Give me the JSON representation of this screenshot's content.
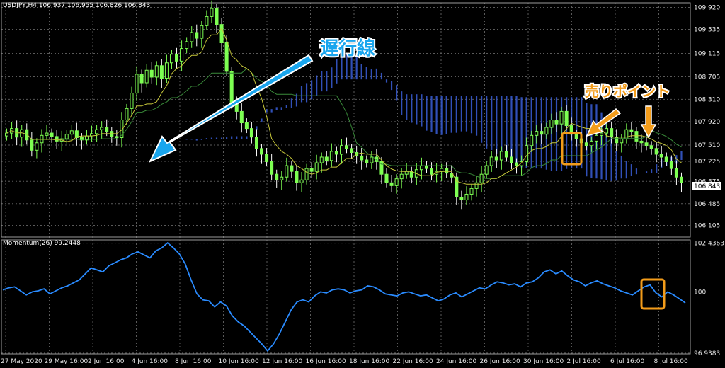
{
  "header": {
    "symbol_line": "USDJPY,H4  106.937 106.955 106.826 106.843"
  },
  "momentum_header": "Momentum(26) 99.2448",
  "annotations": {
    "lagging_span": "遅行線",
    "sell_point": "売りポイント"
  },
  "price_badge": "106.843",
  "colors": {
    "bull_candle": "#7dff52",
    "bear_candle": "#ffffff",
    "lagging_span": "#ff69b4",
    "tenkan": "#c8c83a",
    "kijun": "#3a8c3a",
    "cloud": "#3a5fd9",
    "momentum": "#2a8bff",
    "grid": "#5a5a5a",
    "arrow_blue": "#1aa6ee",
    "marker_orange": "#f39c1a"
  },
  "chart_data": [
    {
      "type": "candlestick",
      "title": "USDJPY,H4",
      "ylim": [
        105.9,
        110.0
      ],
      "y_ticks": [
        "109.920",
        "109.535",
        "109.115",
        "108.705",
        "108.310",
        "107.920",
        "107.510",
        "107.225",
        "106.875",
        "106.485",
        "106.105"
      ],
      "y_tick_values": [
        109.92,
        109.535,
        109.115,
        108.705,
        108.31,
        107.92,
        107.51,
        107.225,
        106.875,
        106.485,
        106.105
      ],
      "x_ticks": [
        "27 May 2020",
        "29 May 16:00",
        "2 Jun 16:00",
        "4 Jun 16:00",
        "8 Jun 16:00",
        "10 Jun 16:00",
        "12 Jun 16:00",
        "16 Jun 16:00",
        "18 Jun 16:00",
        "22 Jun 16:00",
        "24 Jun 16:00",
        "26 Jun 16:00",
        "30 Jun 16:00",
        "2 Jul 16:00",
        "6 Jul 16:00",
        "8 Jul 16:00"
      ],
      "close": [
        107.72,
        107.8,
        107.65,
        107.78,
        107.6,
        107.42,
        107.55,
        107.68,
        107.72,
        107.66,
        107.58,
        107.62,
        107.7,
        107.76,
        107.64,
        107.6,
        107.67,
        107.71,
        107.78,
        107.82,
        107.75,
        107.66,
        107.64,
        107.95,
        108.15,
        108.42,
        108.75,
        108.6,
        108.82,
        108.7,
        108.9,
        108.68,
        108.95,
        109.1,
        108.98,
        109.2,
        109.32,
        109.48,
        109.38,
        109.6,
        109.76,
        109.9,
        109.62,
        109.3,
        108.8,
        108.25,
        108.1,
        107.9,
        107.8,
        107.65,
        107.45,
        107.35,
        107.22,
        107.0,
        106.9,
        106.95,
        107.15,
        107.05,
        106.85,
        106.9,
        107.1,
        107.05,
        107.2,
        107.3,
        107.24,
        107.4,
        107.35,
        107.5,
        107.45,
        107.38,
        107.32,
        107.25,
        107.2,
        107.3,
        107.22,
        107.0,
        106.85,
        106.8,
        106.92,
        107.0,
        107.05,
        106.95,
        107.08,
        107.15,
        107.1,
        107.0,
        107.05,
        107.1,
        107.02,
        106.95,
        106.6,
        106.55,
        106.65,
        106.75,
        106.85,
        107.0,
        107.15,
        107.3,
        107.25,
        107.4,
        107.3,
        107.2,
        107.15,
        107.22,
        107.5,
        107.68,
        107.75,
        107.7,
        107.82,
        107.95,
        107.88,
        108.1,
        107.85,
        107.7,
        107.62,
        107.55,
        107.5,
        107.58,
        107.68,
        107.72,
        107.8,
        107.65,
        107.55,
        107.62,
        107.78,
        107.75,
        107.58,
        107.55,
        107.5,
        107.45,
        107.35,
        107.3,
        107.22,
        107.1,
        106.95,
        106.85
      ]
    },
    {
      "type": "line",
      "title": "Momentum(26) 99.2448",
      "ylim": [
        96.9,
        102.6
      ],
      "y_ticks": [
        "102.4363",
        "100",
        "96.9383"
      ],
      "y_tick_values": [
        102.4363,
        100,
        96.9383
      ],
      "values": [
        100.1,
        100.2,
        100.25,
        100.05,
        99.85,
        100.0,
        100.05,
        100.15,
        99.9,
        100.05,
        100.2,
        100.3,
        100.45,
        100.6,
        100.9,
        101.2,
        101.1,
        101.0,
        101.3,
        101.45,
        101.6,
        101.7,
        101.9,
        102.0,
        101.85,
        101.7,
        102.05,
        102.2,
        102.45,
        102.2,
        101.9,
        101.4,
        100.6,
        99.9,
        99.6,
        99.55,
        99.25,
        99.5,
        99.3,
        98.8,
        98.5,
        98.3,
        98.0,
        97.7,
        97.4,
        97.05,
        97.4,
        97.9,
        98.5,
        99.1,
        99.5,
        99.6,
        99.5,
        99.8,
        100.0,
        99.95,
        100.1,
        100.15,
        100.1,
        99.95,
        100.05,
        100.1,
        100.3,
        100.25,
        100.1,
        99.9,
        99.85,
        99.8,
        99.95,
        100.0,
        99.9,
        99.8,
        99.85,
        99.7,
        99.55,
        99.65,
        99.85,
        99.95,
        99.75,
        99.9,
        100.05,
        100.2,
        100.15,
        100.35,
        100.5,
        100.45,
        100.35,
        100.4,
        100.25,
        100.45,
        100.5,
        100.7,
        101.0,
        101.1,
        100.9,
        101.05,
        100.8,
        100.6,
        100.5,
        100.3,
        100.45,
        100.55,
        100.4,
        100.3,
        100.2,
        100.05,
        99.95,
        99.85,
        100.05,
        100.25,
        100.35,
        99.95,
        99.75,
        100.0,
        99.85,
        99.65,
        99.45
      ]
    }
  ]
}
